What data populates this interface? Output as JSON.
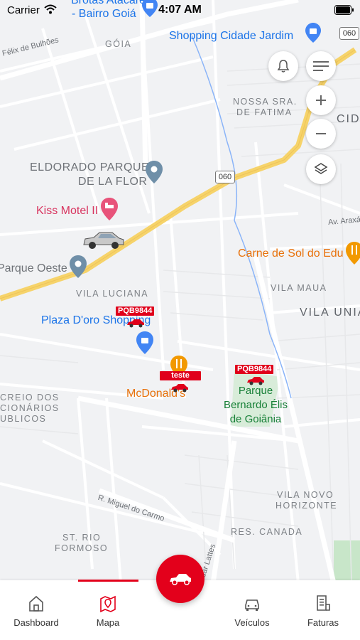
{
  "status_bar": {
    "carrier": "Carrier",
    "time": "4:07 AM"
  },
  "map": {
    "districts": [
      "GÓIA",
      "NOSSA SRA.",
      "DE FATIMA",
      "CID",
      "VILA LUCIANA",
      "VILA MAUA",
      "VILA UNIA",
      "CREIO DOS",
      "CIONÁRIOS",
      "UBLICOS",
      "VILA NOVO",
      "HORIZONTE",
      "RES. CANADA",
      "ST. RIO",
      "FORMOSO"
    ],
    "pois": {
      "brotas": "Brotas Atacarejo",
      "brotas2": "- Bairro Goiá",
      "shopping_cidade_jardim": "Shopping Cidade Jardim",
      "eldorado1": "ELDORADO PARQUE",
      "eldorado2": "DE LA FLOR",
      "kiss_motel": "Kiss Motel II",
      "parque_oeste": "Parque Oeste",
      "carne_de_sol": "Carne de Sol do Edu",
      "plaza_doro": "Plaza D'oro Shopping",
      "mcdonalds": "McDonald's",
      "parque_bernardo1": "Parque",
      "parque_bernardo2": "Bernardo Élis",
      "parque_bernardo3": "de Goiânia"
    },
    "streets": {
      "felix": "Félix de Bulhões",
      "araxa": "Av. Araxá",
      "miguel": "R. Miguel do Carmo",
      "cesar": "Av. César Lattes"
    },
    "route_shields": [
      "060",
      "060"
    ],
    "vehicles": [
      {
        "plate": "PQB9844",
        "color": "#e0001b"
      },
      {
        "plate": "teste",
        "color": "#e0001b"
      },
      {
        "plate": "PQB9844",
        "color": "#e0001b"
      },
      {
        "plate": "",
        "color": "#c8c8c8"
      }
    ]
  },
  "controls": [
    "bell-icon",
    "menu-icon",
    "zoom-in-icon",
    "zoom-out-icon",
    "layers-icon"
  ],
  "tabs": [
    {
      "label": "Dashboard",
      "icon": "home-icon"
    },
    {
      "label": "Mapa",
      "icon": "map-icon",
      "active": true
    },
    {
      "label": "Veículos",
      "icon": "car-icon"
    },
    {
      "label": "Faturas",
      "icon": "invoice-icon"
    }
  ],
  "colors": {
    "accent": "#e3001b",
    "highway": "#f6d36a",
    "water": "#8ab4f8",
    "park": "#c8e6c9"
  }
}
